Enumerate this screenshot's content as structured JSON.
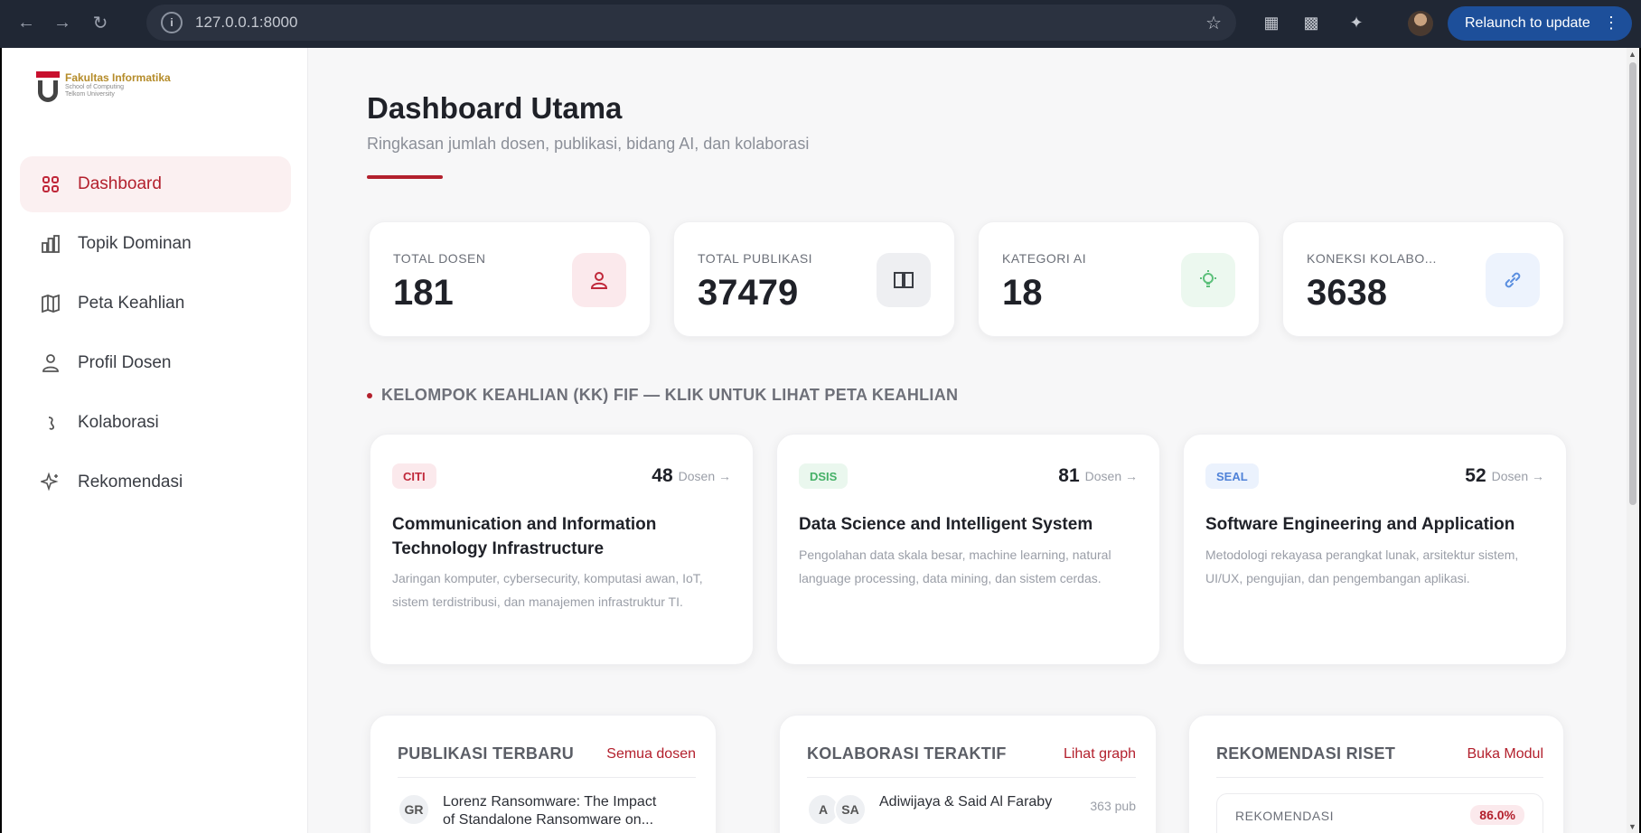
{
  "browser": {
    "url": "127.0.0.1:8000",
    "relaunch_label": "Relaunch to update",
    "icons": [
      "back-arrow-icon",
      "forward-arrow-icon",
      "reload-icon",
      "site-info-icon",
      "star-icon",
      "extension-icon",
      "tab-search-icon",
      "puzzle-icon",
      "profile-avatar",
      "menu-dots-icon"
    ]
  },
  "sidebar": {
    "logo": {
      "line1": "Fakultas Informatika",
      "line2": "School of Computing",
      "line3": "Telkom University"
    },
    "items": [
      {
        "label": "Dashboard",
        "icon": "grid-icon",
        "active": true
      },
      {
        "label": "Topik Dominan",
        "icon": "bar-chart-icon",
        "active": false
      },
      {
        "label": "Peta Keahlian",
        "icon": "map-icon",
        "active": false
      },
      {
        "label": "Profil Dosen",
        "icon": "users-icon",
        "active": false
      },
      {
        "label": "Kolaborasi",
        "icon": "link-icon",
        "active": false
      },
      {
        "label": "Rekomendasi",
        "icon": "sparkle-icon",
        "active": false
      }
    ]
  },
  "header": {
    "title": "Dashboard Utama",
    "subtitle": "Ringkasan jumlah dosen, publikasi, bidang AI, dan kolaborasi"
  },
  "stats": [
    {
      "label": "TOTAL DOSEN",
      "value": "181",
      "icon": "users-icon",
      "color": "#c0283a",
      "bg": "#fbe9ec"
    },
    {
      "label": "TOTAL PUBLIKASI",
      "value": "37479",
      "icon": "book-icon",
      "color": "#3a3d44",
      "bg": "#eeeff2"
    },
    {
      "label": "KATEGORI AI",
      "value": "18",
      "icon": "lightbulb-icon",
      "color": "#5cc07a",
      "bg": "#ecf8ef"
    },
    {
      "label": "KONEKSI KOLABO...",
      "value": "3638",
      "icon": "link-icon",
      "color": "#5b8fe0",
      "bg": "#edf3fd"
    }
  ],
  "kk_section": {
    "heading": "KELOMPOK KEAHLIAN (KK) FIF — KLIK UNTUK LIHAT PETA KEAHLIAN",
    "unit": "Dosen →",
    "cards": [
      {
        "tag": "CITI",
        "tag_color": "#c0283a",
        "tag_bg": "#fbe9ec",
        "count": "48",
        "name": "Communication and Information Technology Infrastructure",
        "desc": "Jaringan komputer, cybersecurity, komputasi awan, IoT, sistem terdistribusi, dan manajemen infrastruktur TI."
      },
      {
        "tag": "DSIS",
        "tag_color": "#45b067",
        "tag_bg": "#eaf7ee",
        "count": "81",
        "name": "Data Science and Intelligent System",
        "desc": "Pengolahan data skala besar, machine learning, natural language processing, data mining, dan sistem cerdas."
      },
      {
        "tag": "SEAL",
        "tag_color": "#4f82d8",
        "tag_bg": "#ebf2fd",
        "count": "52",
        "name": "Software Engineering and Application",
        "desc": "Metodologi rekayasa perangkat lunak, arsitektur sistem, UI/UX, pengujian, dan pengembangan aplikasi."
      }
    ]
  },
  "panels": {
    "publikasi": {
      "title": "PUBLIKASI TERBARU",
      "link": "Semua dosen",
      "row": {
        "avatar": "GR",
        "text": "Lorenz Ransomware: The Impact of Standalone Ransomware on..."
      }
    },
    "kolaborasi": {
      "title": "KOLABORASI TERAKTIF",
      "link": "Lihat graph",
      "row": {
        "avatar1": "A",
        "avatar2": "SA",
        "text": "Adiwijaya & Said Al Faraby",
        "meta": "363 pub"
      }
    },
    "rekomendasi": {
      "title": "REKOMENDASI RISET",
      "link": "Buka Modul",
      "box_label": "REKOMENDASI",
      "box_pct": "86.0%"
    }
  }
}
